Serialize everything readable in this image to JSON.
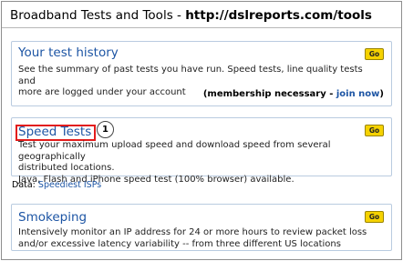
{
  "header": {
    "title_prefix": "Broadband Tests and Tools - ",
    "title_url": "http://dslreports.com/tools"
  },
  "sections": [
    {
      "title": "Your test history",
      "go_label": "Go",
      "lines": [
        "See the summary of past tests you have run. Speed tests, line quality tests and",
        "more are logged under your account"
      ],
      "membership_prefix": "(membership necessary - ",
      "membership_link": "join now",
      "membership_suffix": ")"
    },
    {
      "title": "Speed Tests",
      "go_label": "Go",
      "lines": [
        "Test your maximum upload speed and download speed from several geographically",
        "distributed locations.",
        "Java, Flash and iPhone speed test (100% browser) available."
      ]
    },
    {
      "title": "Smokeping",
      "go_label": "Go",
      "lines": [
        "Intensively monitor an IP address for 24 or more hours to review packet loss",
        "and/or excessive latency variability -- from three different US locations"
      ]
    }
  ],
  "data_row": {
    "label": "Data:",
    "link": "Speediest ISPs"
  },
  "annotation": {
    "badge_number": "1",
    "highlight_color": "#e21b1b"
  }
}
